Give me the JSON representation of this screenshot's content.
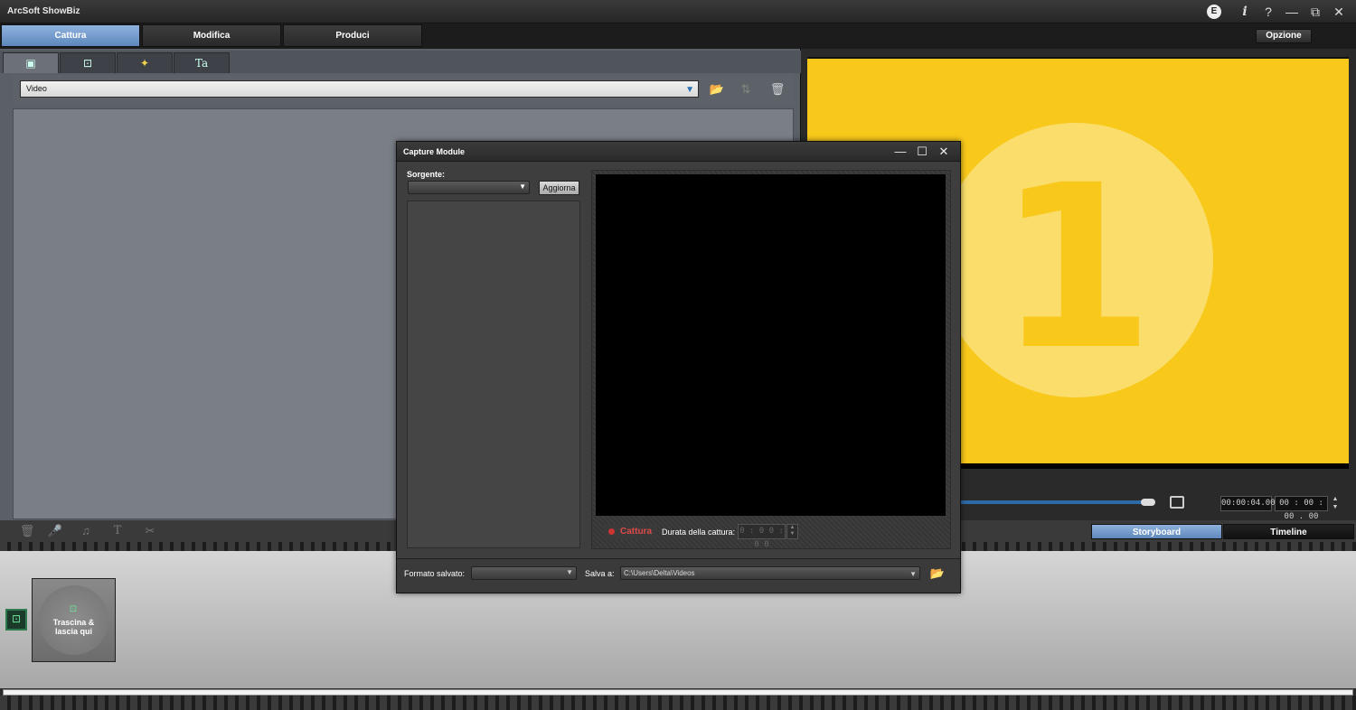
{
  "window": {
    "title": "ArcSoft ShowBiz",
    "badge": "E",
    "info": "i",
    "help": "?",
    "minimize": "—",
    "restore": "⧉",
    "close": "✕"
  },
  "main_tabs": [
    {
      "label": "Cattura",
      "active": true
    },
    {
      "label": "Modifica",
      "active": false
    },
    {
      "label": "Produci",
      "active": false
    }
  ],
  "options_label": "Opzione",
  "sub_tabs": [
    {
      "icon": "capture-media-icon",
      "glyph": "▣"
    },
    {
      "icon": "film-icon",
      "glyph": "⊡"
    },
    {
      "icon": "effects-icon",
      "glyph": "✦"
    },
    {
      "icon": "text-icon",
      "glyph": "Ta"
    }
  ],
  "media_toolbar": {
    "select_value": "Video",
    "select_arrow": "▼",
    "import_glyph": "📂",
    "sort_glyph": "⇅",
    "delete_glyph": "🗑"
  },
  "preview": {
    "countdown_number": "1",
    "timecode_current": "00:00:04.00",
    "timecode_total": "00 : 00 : 00 . 00",
    "spin_up": "▲",
    "spin_down": "▼",
    "colors": {
      "background": "#f8c81a",
      "circle": "#fbe07a"
    }
  },
  "bottom_tools": [
    {
      "icon": "trash-icon",
      "glyph": "🗑"
    },
    {
      "icon": "microphone-icon",
      "glyph": "🎤"
    },
    {
      "icon": "music-icon",
      "glyph": "♫"
    },
    {
      "icon": "text-icon",
      "glyph": "T"
    },
    {
      "icon": "scissors-icon",
      "glyph": "✂"
    }
  ],
  "view_tabs": {
    "storyboard": "Storyboard",
    "timeline": "Timeline"
  },
  "storyboard": {
    "clip_glyph": "⊡",
    "drop_glyph": "⊡",
    "drop_text_line1": "Trascina &",
    "drop_text_line2": "lascia qui"
  },
  "capture_dialog": {
    "title": "Capture Module",
    "minimize": "—",
    "maximize": "☐",
    "close": "✕",
    "source_label": "Sorgente:",
    "source_value": "",
    "source_arrow": "▼",
    "refresh_label": "Aggiorna",
    "capture_label": "Cattura",
    "duration_label": "Durata della cattura:",
    "duration_value": "0 : 0 0 : 0 0",
    "spin_up": "▲",
    "spin_down": "▼",
    "format_label": "Formato salvato:",
    "format_arrow": "▼",
    "save_label": "Salva a:",
    "save_path": "C:\\Users\\Delta\\Videos",
    "save_arrow": "▼",
    "folder_glyph": "📂"
  }
}
